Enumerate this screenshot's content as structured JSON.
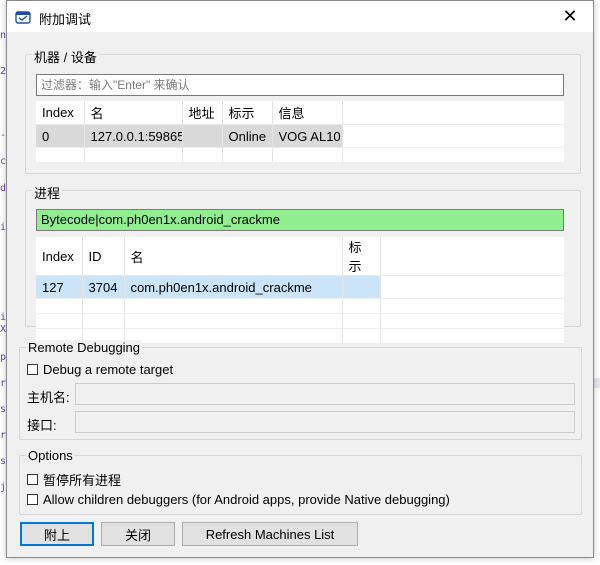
{
  "window": {
    "title": "附加调试",
    "close_glyph": "✕"
  },
  "machines": {
    "group_label": "机器 / 设备",
    "filter_placeholder": "过滤器：输入\"Enter\" 来确认",
    "columns": [
      "Index",
      "名",
      "地址",
      "标示",
      "信息"
    ],
    "rows": [
      {
        "index": "0",
        "name": "127.0.0.1:59865",
        "address": "",
        "tag": "Online",
        "info": "VOG AL10"
      }
    ]
  },
  "processes": {
    "group_label": "进程",
    "filter_value": "Bytecode|com.ph0en1x.android_crackme",
    "columns": [
      "Index",
      "ID",
      "名",
      "标示"
    ],
    "rows": [
      {
        "index": "127",
        "id": "3704",
        "name": "com.ph0en1x.android_crackme",
        "tag": ""
      }
    ]
  },
  "remote": {
    "group_label": "Remote Debugging",
    "checkbox_label": "Debug a remote target",
    "host_label": "主机名:",
    "port_label": "接口:",
    "host_value": "",
    "port_value": ""
  },
  "options": {
    "group_label": "Options",
    "pause_all_label": "暂停所有进程",
    "allow_children_label": "Allow children debuggers (for Android apps, provide Native debugging)"
  },
  "buttons": {
    "attach": "附上",
    "close": "关闭",
    "refresh": "Refresh Machines List"
  },
  "colors": {
    "accent": "#0078d7",
    "process_filter_bg": "#90ee90",
    "selected_row_blue": "#cce4f7",
    "selected_row_gray": "#d9d9d9"
  }
}
